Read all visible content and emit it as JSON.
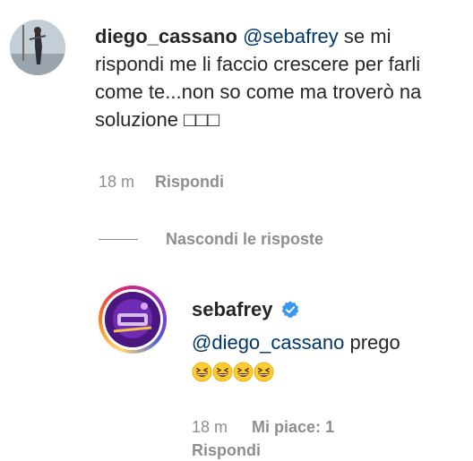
{
  "comment": {
    "username": "diego_cassano",
    "mention": "@sebafrey",
    "text": " se mi rispondi me li faccio crescere per farli come te...non so come ma troverò na soluzione □□□",
    "time": "18 m",
    "reply_label": "Rispondi"
  },
  "hide_replies_label": "Nascondi le risposte",
  "reply": {
    "username": "sebafrey",
    "verified_icon": "verified-badge-icon",
    "mention": "@diego_cassano",
    "text": " prego",
    "emoji_icon": "grinning-squinting-face-emoji",
    "emoji_count": 4,
    "time": "18 m",
    "likes_label": "Mi piace: 1",
    "reply_label": "Rispondi"
  },
  "colors": {
    "text": "#262626",
    "secondary": "#8e8e8e",
    "mention": "#00376b",
    "verified": "#3897f0"
  }
}
